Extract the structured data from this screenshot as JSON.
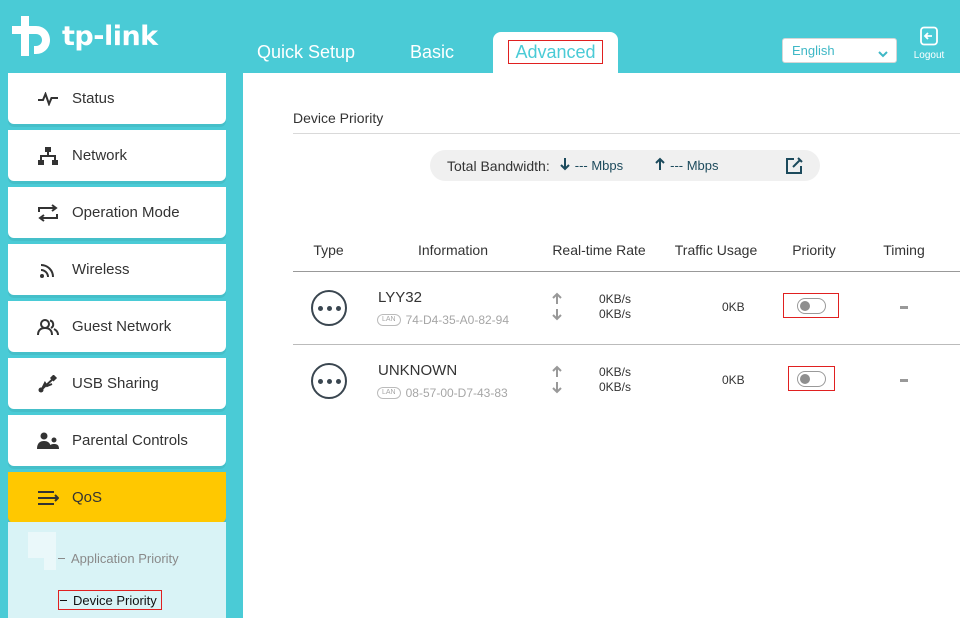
{
  "brand": {
    "name": "tp-link"
  },
  "nav": {
    "tabs": [
      {
        "label": "Quick Setup"
      },
      {
        "label": "Basic"
      },
      {
        "label": "Advanced",
        "active": true
      }
    ],
    "language": "English",
    "logout_label": "Logout"
  },
  "sidebar": {
    "items": [
      {
        "label": "Status",
        "icon": "pulse-icon"
      },
      {
        "label": "Network",
        "icon": "network-topology-icon"
      },
      {
        "label": "Operation Mode",
        "icon": "swap-arrows-icon"
      },
      {
        "label": "Wireless",
        "icon": "wifi-icon"
      },
      {
        "label": "Guest Network",
        "icon": "guests-icon"
      },
      {
        "label": "USB Sharing",
        "icon": "usb-icon"
      },
      {
        "label": "Parental Controls",
        "icon": "parent-child-icon"
      },
      {
        "label": "QoS",
        "icon": "qos-icon",
        "active": true
      }
    ],
    "submenu": [
      {
        "label": "Application Priority"
      },
      {
        "label": "Device Priority",
        "active": true
      }
    ]
  },
  "main": {
    "section_title": "Device Priority",
    "bandwidth": {
      "label": "Total Bandwidth:",
      "down": "--- Mbps",
      "up": "--- Mbps"
    },
    "table": {
      "headers": [
        "Type",
        "Information",
        "Real-time Rate",
        "Traffic Usage",
        "Priority",
        "Timing"
      ],
      "rows": [
        {
          "name": "LYY32",
          "lan_badge": "LAN",
          "mac": "74-D4-35-A0-82-94",
          "rate_up": "0KB/s",
          "rate_down": "0KB/s",
          "usage": "0KB",
          "priority_on": false
        },
        {
          "name": "UNKNOWN",
          "lan_badge": "LAN",
          "mac": "08-57-00-D7-43-83",
          "rate_up": "0KB/s",
          "rate_down": "0KB/s",
          "usage": "0KB",
          "priority_on": false
        }
      ]
    }
  },
  "colors": {
    "header_bg": "#4acbd6",
    "active_item": "#ffc800",
    "highlight_box": "#e02020"
  }
}
